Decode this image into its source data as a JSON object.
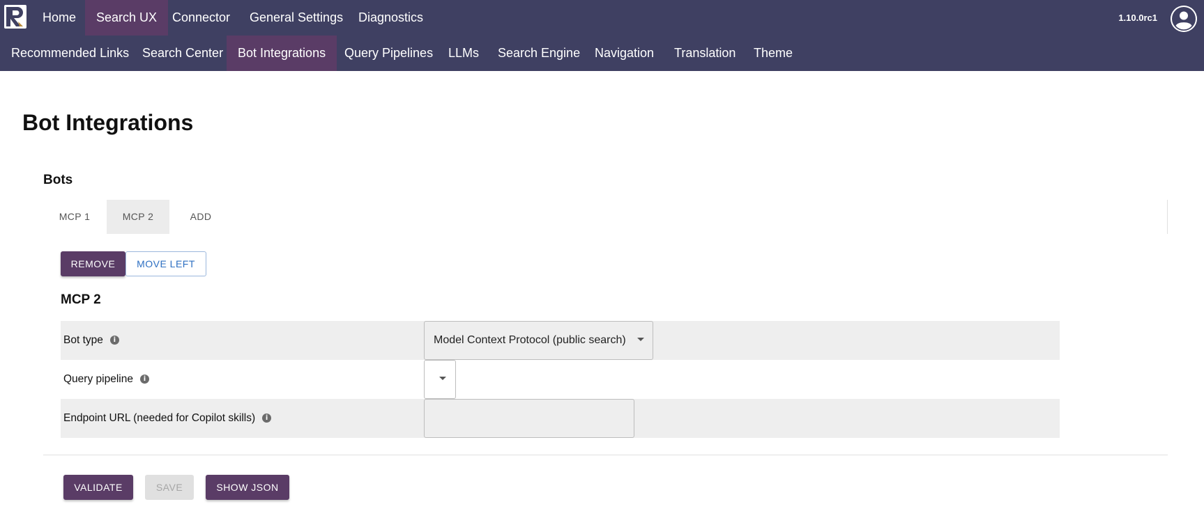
{
  "top_nav": {
    "primary": [
      {
        "label": "Home",
        "active": false
      },
      {
        "label": "Search UX",
        "active": true
      },
      {
        "label": "Connector",
        "active": false
      },
      {
        "label": "General Settings",
        "active": false
      },
      {
        "label": "Diagnostics",
        "active": false
      }
    ],
    "secondary": [
      {
        "label": "Recommended Links",
        "active": false
      },
      {
        "label": "Search Center",
        "active": false
      },
      {
        "label": "Bot Integrations",
        "active": true
      },
      {
        "label": "Query Pipelines",
        "active": false
      },
      {
        "label": "LLMs",
        "active": false
      },
      {
        "label": "Search Engine",
        "active": false
      },
      {
        "label": "Navigation",
        "active": false
      },
      {
        "label": "Translation",
        "active": false
      },
      {
        "label": "Theme",
        "active": false
      }
    ],
    "version": "1.10.0rc1",
    "colors": {
      "bar": "#3f4062",
      "active": "#5a3c66"
    }
  },
  "page": {
    "title": "Bot Integrations",
    "section_title": "Bots"
  },
  "tabs": [
    {
      "label": "MCP 1",
      "active": false
    },
    {
      "label": "MCP 2",
      "active": true
    },
    {
      "label": "ADD",
      "active": false
    }
  ],
  "actions": {
    "remove": "REMOVE",
    "move_left": "MOVE LEFT"
  },
  "bot": {
    "name": "MCP 2",
    "fields": {
      "bot_type": {
        "label": "Bot type",
        "value": "Model Context Protocol (public search)"
      },
      "query_pipeline": {
        "label": "Query pipeline",
        "value": ""
      },
      "endpoint_url": {
        "label": "Endpoint URL (needed for Copilot skills)",
        "value": ""
      }
    }
  },
  "footer": {
    "validate": "VALIDATE",
    "save": "SAVE",
    "show_json": "SHOW JSON"
  },
  "icons": {
    "info": "info-icon",
    "logo": "r-logo-icon",
    "avatar": "user-avatar-icon",
    "dropdown": "caret-down-icon"
  }
}
